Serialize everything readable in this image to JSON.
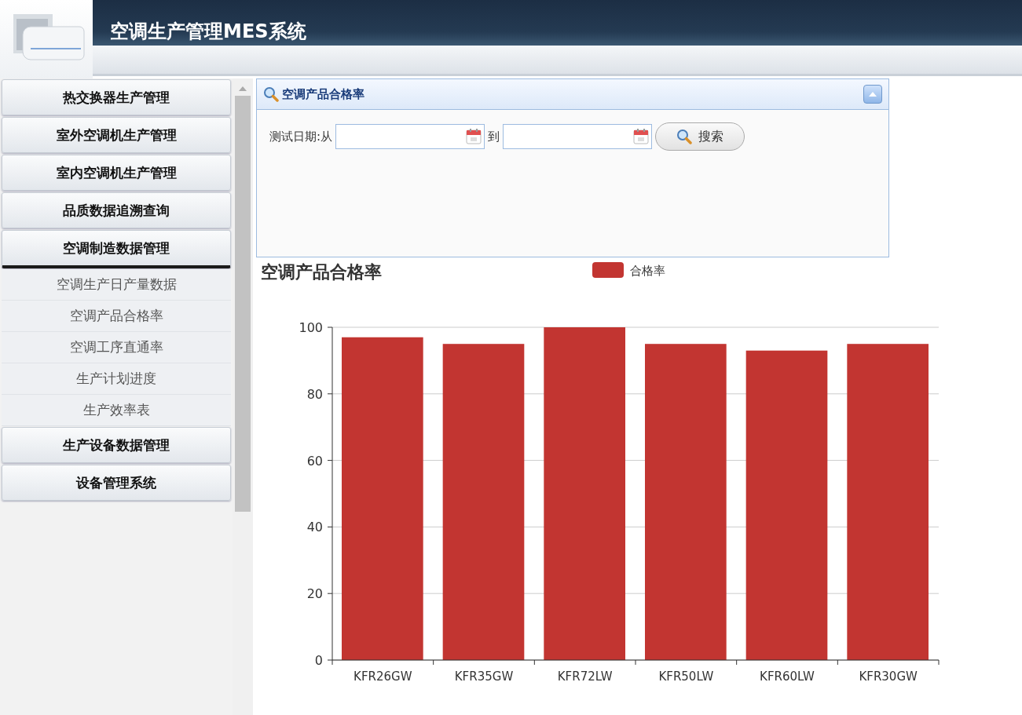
{
  "header": {
    "title": "空调生产管理MES系统"
  },
  "sidebar": {
    "groups": [
      {
        "label": "热交换器生产管理",
        "expanded": false
      },
      {
        "label": "室外空调机生产管理",
        "expanded": false
      },
      {
        "label": "室内空调机生产管理",
        "expanded": false
      },
      {
        "label": "品质数据追溯查询",
        "expanded": false
      },
      {
        "label": "空调制造数据管理",
        "expanded": true,
        "children": [
          {
            "label": "空调生产日产量数据"
          },
          {
            "label": "空调产品合格率"
          },
          {
            "label": "空调工序直通率"
          },
          {
            "label": "生产计划进度"
          },
          {
            "label": "生产效率表"
          }
        ]
      },
      {
        "label": "生产设备数据管理",
        "expanded": false
      },
      {
        "label": "设备管理系统",
        "expanded": false
      }
    ]
  },
  "search_panel": {
    "title": "空调产品合格率",
    "date_label": "测试日期:从",
    "to_label": "到",
    "search_button": "搜索"
  },
  "chart_data": {
    "type": "bar",
    "title": "空调产品合格率",
    "categories": [
      "KFR26GW",
      "KFR35GW",
      "KFR72LW",
      "KFR50LW",
      "KFR60LW",
      "KFR30GW"
    ],
    "series": [
      {
        "name": "合格率",
        "color": "#c23531",
        "values": [
          97,
          95,
          100,
          95,
          93,
          95
        ]
      }
    ],
    "grid": true,
    "ylim": [
      0,
      100
    ],
    "yticks": [
      0,
      20,
      40,
      60,
      80,
      100
    ]
  }
}
